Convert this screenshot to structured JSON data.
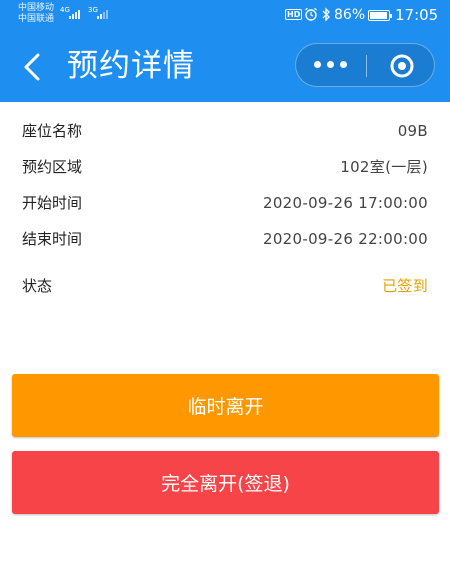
{
  "status_bar": {
    "carrier_1": "中国移动",
    "carrier_2": "中国联通",
    "net_1": "4G",
    "net_2": "3G",
    "hd": "HD",
    "battery": "86%",
    "time": "17:05"
  },
  "header": {
    "title": "预约详情",
    "background": "#1e8ff0"
  },
  "details": [
    {
      "label": "座位名称",
      "value": "09B"
    },
    {
      "label": "预约区域",
      "value": "102室(一层)"
    },
    {
      "label": "开始时间",
      "value": "2020-09-26 17:00:00"
    },
    {
      "label": "结束时间",
      "value": "2020-09-26 22:00:00"
    },
    {
      "label": "状态",
      "value": "已签到"
    }
  ],
  "colors": {
    "status": "#e6a100",
    "temp_leave_button": "#ff9800",
    "full_leave_button": "#f64448"
  },
  "actions": {
    "temp_leave": "临时离开",
    "full_leave": "完全离开(签退)"
  }
}
